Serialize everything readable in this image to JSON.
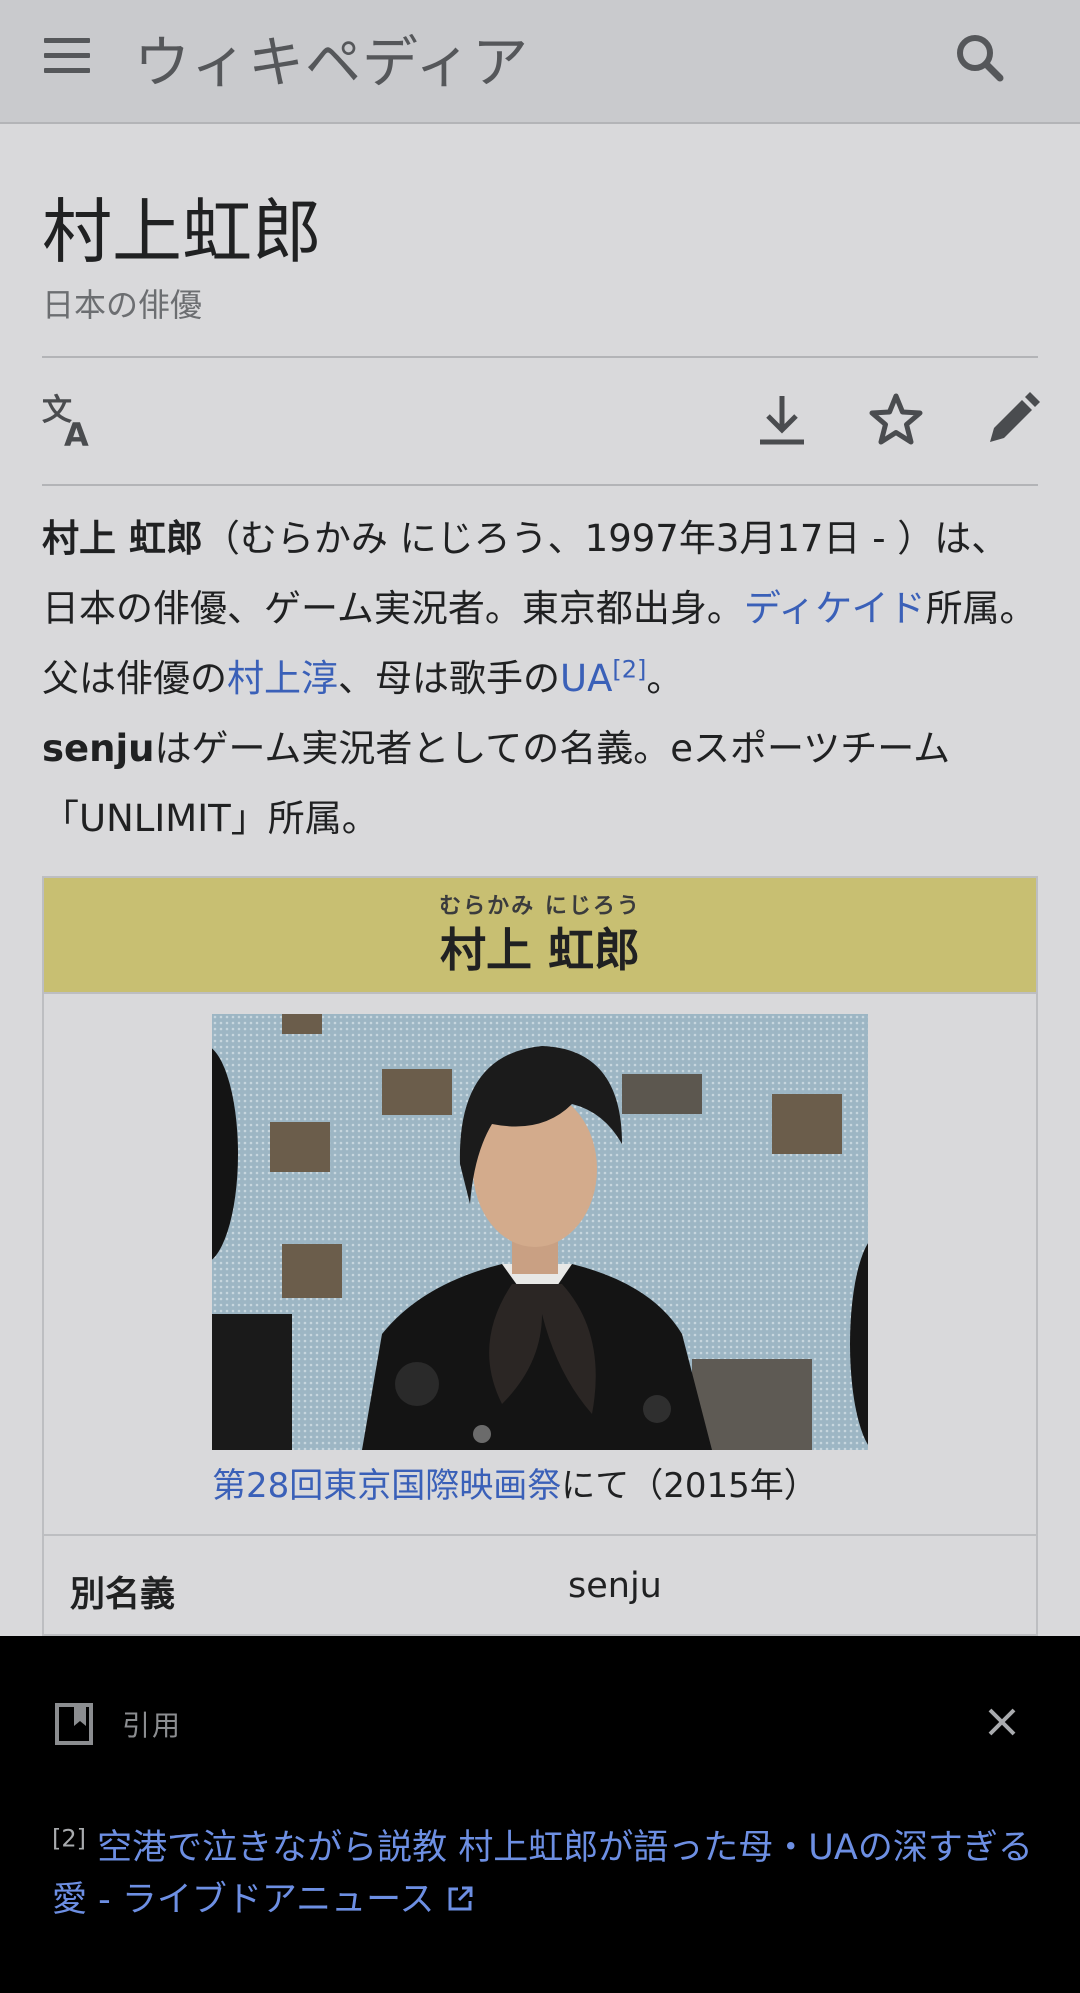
{
  "header": {
    "wordmark": "ウィキペディア",
    "menu_icon": "menu-icon",
    "search_icon": "search-icon"
  },
  "article": {
    "title": "村上虹郎",
    "description": "日本の俳優"
  },
  "actions": {
    "language_icon": "language-icon",
    "download_icon": "download-icon",
    "watch_icon": "star-icon",
    "edit_icon": "pencil-icon"
  },
  "lead": {
    "name_bold": "村上 虹郎",
    "t1": "（むらかみ にじろう、1997年3月17日 - ）は、日本の俳優、ゲーム実況者。東京都出身。",
    "link_agency": "ディケイド",
    "t2": "所属。父は俳優の",
    "link_father": "村上淳",
    "t3": "、母は歌手の",
    "link_mother": "UA",
    "ref_mark": "[2]",
    "t4": "。",
    "alias_bold": "senju",
    "t5": "はゲーム実況者としての名義。eスポーツチーム「UNLIMIT」所属。"
  },
  "infobox": {
    "ruby": "むらかみ にじろう",
    "name": "村上 虹郎",
    "caption_link": "第28回東京国際映画祭",
    "caption_text": "にて（2015年）",
    "rows": [
      {
        "label": "別名義",
        "value": "senju"
      }
    ]
  },
  "citation_sheet": {
    "title": "引用",
    "ref_num": "[2]",
    "ref_text": "空港で泣きながら説教 村上虹郎が語った母・UAの深すぎる愛 - ライブドアニュース",
    "external_icon": "external-link-icon",
    "close_icon": "close-icon"
  },
  "colors": {
    "link": "#3a60b8",
    "infobox_header": "#c8bf72",
    "sheet_bg": "#000000",
    "sheet_link": "#6d8fe3"
  }
}
